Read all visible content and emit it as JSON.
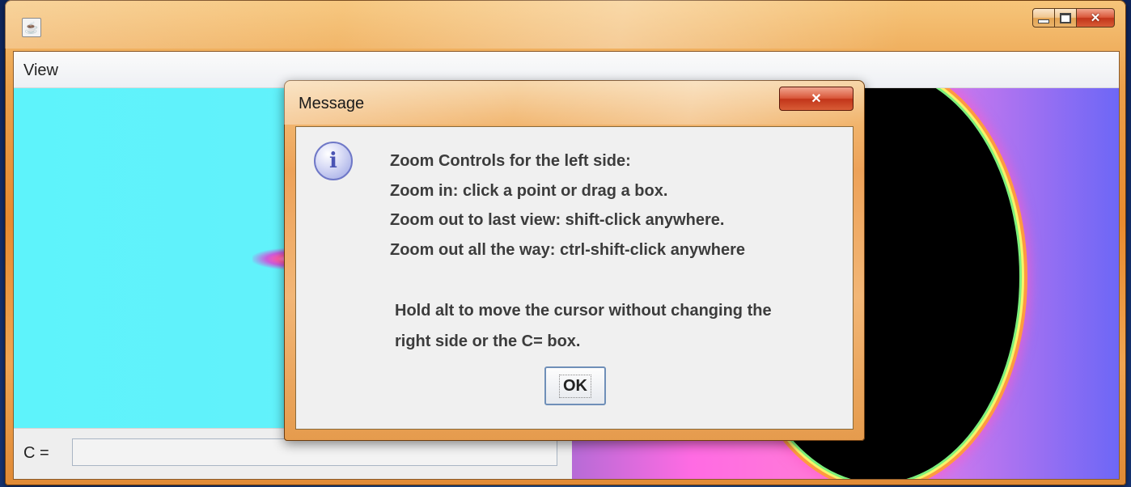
{
  "window": {
    "title": "",
    "app_icon": "java-cup-icon",
    "menu": [
      "View"
    ]
  },
  "main": {
    "c_label": "C =",
    "c_value": ""
  },
  "dialog": {
    "title": "Message",
    "icon": "info-icon",
    "lines": [
      "Zoom Controls for the left side:",
      "Zoom in: click a point or drag a box.",
      "Zoom out to last view: shift-click anywhere.",
      "Zoom out all the way: ctrl-shift-click anywhere"
    ],
    "lines2": [
      "Hold alt to move the cursor without changing the",
      "right side or the C= box."
    ],
    "ok_label": "OK"
  }
}
